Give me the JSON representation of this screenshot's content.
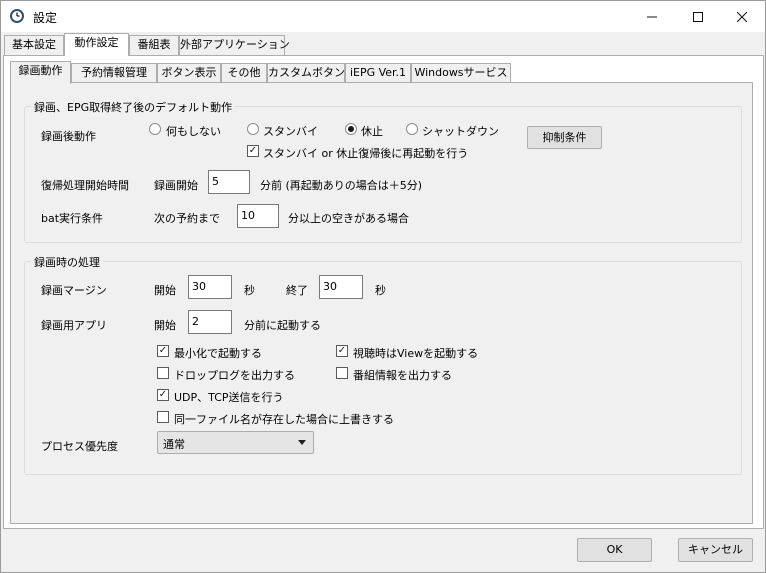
{
  "window": {
    "title": "設定",
    "minimize": "─",
    "maximize": "☐",
    "close": "✕"
  },
  "top_tabs": [
    "基本設定",
    "動作設定",
    "番組表",
    "外部アプリケーション"
  ],
  "sub_tabs": [
    "録画動作",
    "予約情報管理",
    "ボタン表示",
    "その他",
    "カスタムボタン",
    "iEPG Ver.1",
    "Windowsサービス"
  ],
  "group1": {
    "title": "録画、EPG取得終了後のデフォルト動作",
    "after_rec_label": "録画後動作",
    "radios": [
      "何もしない",
      "スタンバイ",
      "休止",
      "シャットダウン"
    ],
    "selected_radio": "休止",
    "reboot_check": "スタンバイ or 休止復帰後に再起動を行う",
    "suppress_button": "抑制条件",
    "resume_label": "復帰処理開始時間",
    "resume_prefix": "録画開始",
    "resume_value": "5",
    "resume_suffix": "分前 (再起動ありの場合は＋5分)",
    "bat_label": "bat実行条件",
    "bat_prefix": "次の予約まで",
    "bat_value": "10",
    "bat_suffix": "分以上の空きがある場合"
  },
  "group2": {
    "title": "録画時の処理",
    "margin_label": "録画マージン",
    "start_label": "開始",
    "start_value": "30",
    "sec1": "秒",
    "end_label": "終了",
    "end_value": "30",
    "sec2": "秒",
    "app_label": "録画用アプリ",
    "app_start_label": "開始",
    "app_value": "2",
    "app_suffix": "分前に起動する",
    "checks": {
      "minimize": "最小化で起動する",
      "view": "視聴時はViewを起動する",
      "droplog": "ドロップログを出力する",
      "proginfo": "番組情報を出力する",
      "udp": "UDP、TCP送信を行う",
      "overwrite": "同一ファイル名が存在した場合に上書きする"
    },
    "priority_label": "プロセス優先度",
    "priority_value": "通常"
  },
  "footer": {
    "ok": "OK",
    "cancel": "キャンセル"
  },
  "check_mark": "✓"
}
